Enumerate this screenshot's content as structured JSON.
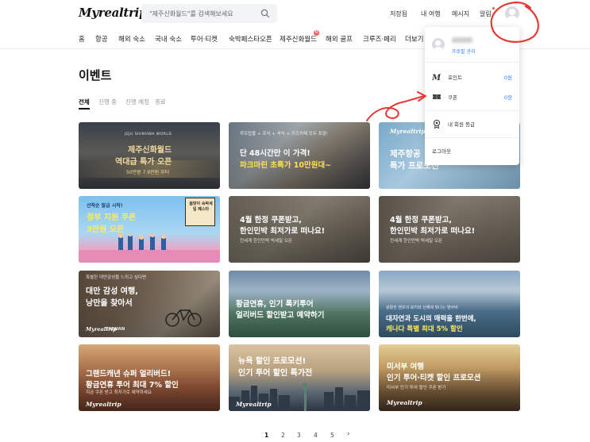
{
  "header": {
    "logo": "Myrealtrip",
    "search_placeholder": "\"제주신화월드\"를 검색해보세요",
    "links": [
      "저장됨",
      "내 여행",
      "메시지",
      "알림"
    ]
  },
  "nav": {
    "items": [
      "홈",
      "항공",
      "해외 숙소",
      "국내 숙소",
      "투어·티켓",
      "숙박페스타오픈",
      "제주신화월드",
      "해외 골프",
      "크루즈·페리",
      "더보기"
    ],
    "badge": "N"
  },
  "page": {
    "title": "이벤트",
    "tabs": [
      "전체",
      "진행 중",
      "진행 예정",
      "종료"
    ]
  },
  "cards": [
    {
      "top": "JEJU SHINHWA WORLD",
      "line1": "제주신화월드",
      "line2": "역대급 특가 오픈",
      "small": "50만원 7.9만원 부터"
    },
    {
      "top": "루프탑풀 + 조식 + 석식 + 키즈카페 모두 포함!",
      "line1": "단 48시간만 이 가격!",
      "line2": "파크마린 초특가 10만원대~",
      "small": ""
    },
    {
      "top": "",
      "line1": "제주항공 ×",
      "line2": "특가 프로모션",
      "small": ""
    },
    {
      "top": "선착순 발급 시작!",
      "line1": "정부 지원 쿠폰",
      "line2": "3만원 오픈",
      "small": "봄맞이 숙박세일 페스타"
    },
    {
      "top": "",
      "line1": "4월 한정 쿠폰받고,",
      "line2": "한인민박 최저가로 떠나요!",
      "small": "전세계 한인민박 빅세일 오픈"
    },
    {
      "top": "",
      "line1": "4월 한정 쿠폰받고,",
      "line2": "한인민박 최저가로 떠나요!",
      "small": "전세계 한인민박 빅세일 오픈"
    },
    {
      "top": "특별한 대만감성을 느끼고 싶다면",
      "line1": "대만 감성 여행,",
      "line2": "낭만을 찾아서",
      "small": "TAIWAN"
    },
    {
      "top": "",
      "line1": "황금연휴, 인기 록키투어",
      "line2": "얼리버드 할인받고 예약하기",
      "small": ""
    },
    {
      "top": "광활한 밴프의 로키와 산해에 빛나는 밴쿠버",
      "line1": "대자연과 도시의 매력을 한번에,",
      "line2": "캐나다 특별 최대 5% 할인",
      "small": ""
    },
    {
      "top": "",
      "line1": "그랜드캐년 슈퍼 얼리버드!",
      "line2": "황금연휴 투어 최대 7% 할인",
      "small": "지금 쿠폰 받고 최저가로 예약하세요"
    },
    {
      "top": "",
      "line1": "뉴욕 할인 프로모션!",
      "line2": "인기 투어 할인 특가전",
      "small": ""
    },
    {
      "top": "",
      "line1": "미서부 여행",
      "line2": "인기 투어·티켓 할인 프로모션",
      "small": "미서부 인기 투어 할인 쿠폰 받기"
    }
  ],
  "brand_tag": "Myrealtrip",
  "pagination": [
    "1",
    "2",
    "3",
    "4",
    "5",
    "›"
  ],
  "dropdown": {
    "profile_link": "프로필 관리",
    "points_label": "포인트",
    "points_value": "0원",
    "coupons_label": "쿠폰",
    "coupons_value": "0장",
    "tier_label": "내 회원 등급",
    "logout_label": "로그아웃"
  },
  "colors": {
    "accent": "#2b7fff",
    "annotation": "#e53935"
  }
}
